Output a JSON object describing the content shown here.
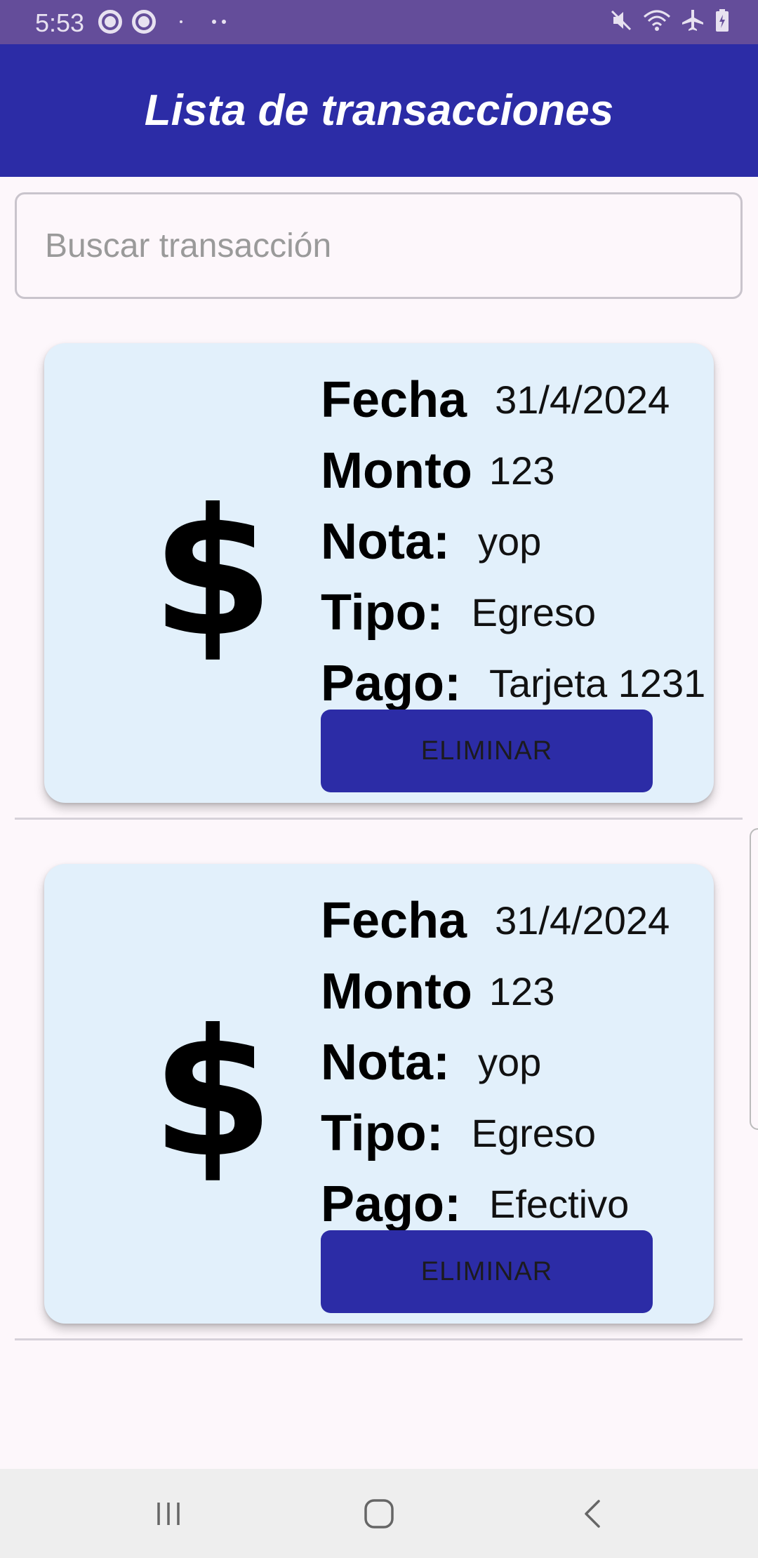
{
  "status_bar": {
    "time": "5:53",
    "left_icons": [
      "pokeball-icon",
      "pokeball-icon",
      "dot-icon",
      "more-dots-icon"
    ],
    "right_icons": [
      "mute-icon",
      "wifi-icon",
      "airplane-icon",
      "battery-charging-icon"
    ]
  },
  "app_bar": {
    "title": "Lista de transacciones",
    "background": "#2c2ca6"
  },
  "search": {
    "placeholder": "Buscar transacción",
    "value": ""
  },
  "labels": {
    "fecha": "Fecha",
    "monto": "Monto",
    "nota": "Nota:",
    "tipo": "Tipo:",
    "pago": "Pago:",
    "delete": "ELIMINAR"
  },
  "transactions": [
    {
      "icon": "$",
      "fecha": "31/4/2024",
      "monto": "123",
      "nota": "yop",
      "tipo": "Egreso",
      "pago": "Tarjeta 1231"
    },
    {
      "icon": "$",
      "fecha": "31/4/2024",
      "monto": "123",
      "nota": "yop",
      "tipo": "Egreso",
      "pago": "Efectivo"
    }
  ],
  "nav_bar": {
    "icons": [
      "recents-icon",
      "home-icon",
      "back-icon"
    ]
  },
  "colors": {
    "status_bar": "#644d9a",
    "accent": "#2c2ca6",
    "card": "#e2f0fb",
    "background": "#fdf7fb"
  }
}
